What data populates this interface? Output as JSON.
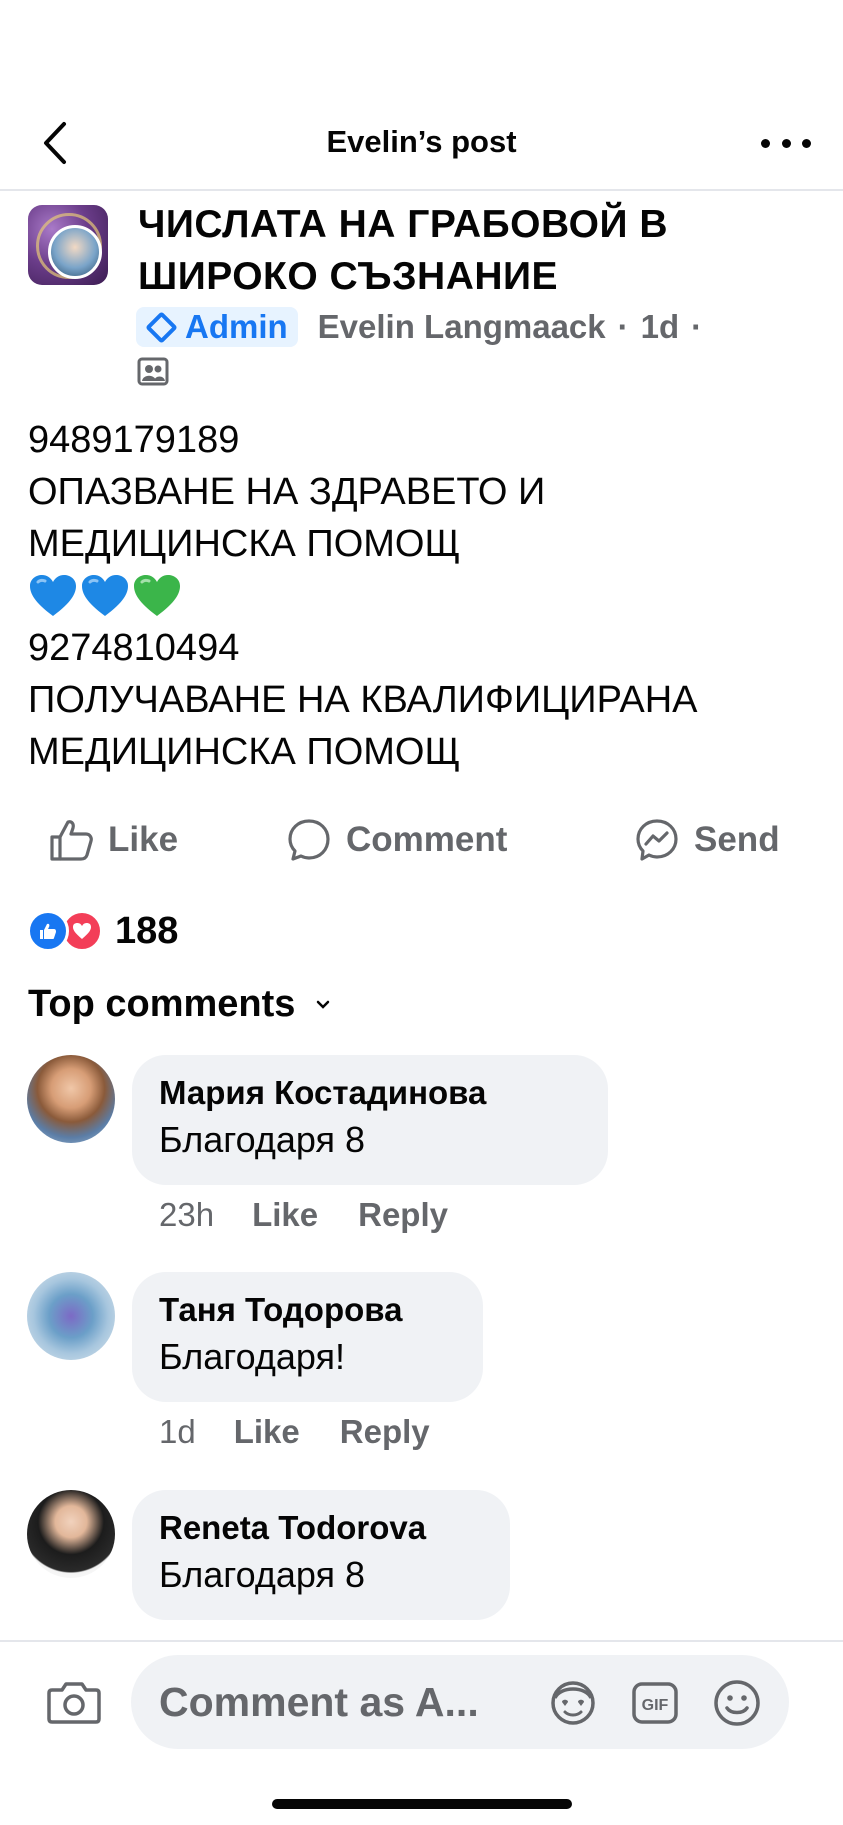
{
  "header": {
    "title": "Evelin’s post"
  },
  "post": {
    "group_name": "ЧИСЛАТА НА ГРАБОВОЙ В ШИРОКО СЪЗНАНИЕ",
    "admin_label": "Admin",
    "author": "Evelin Langmaack",
    "separator": "·",
    "time": "1d",
    "lines": [
      "9489179189",
      "ОПАЗВАНЕ НА ЗДРАВЕТО И",
      "МЕДИЦИНСКА ПОМОЩ",
      "9274810494",
      "ПОЛУЧАВАНЕ НА КВАЛИФИЦИРАНА",
      "МЕДИЦИНСКА ПОМОЩ"
    ],
    "emojis": [
      "blue-heart",
      "blue-heart",
      "green-heart"
    ]
  },
  "actions": {
    "like": "Like",
    "comment": "Comment",
    "send": "Send"
  },
  "reactions": {
    "count": "188",
    "types": [
      "like",
      "love"
    ]
  },
  "comments_section": {
    "title": "Top comments"
  },
  "comments": [
    {
      "name": "Мария Костадинова",
      "text": "Благодаря 8",
      "time": "23h",
      "like": "Like",
      "reply": "Reply"
    },
    {
      "name": "Таня Тодорова",
      "text": "Благодаря!",
      "time": "1d",
      "like": "Like",
      "reply": "Reply"
    },
    {
      "name": "Reneta Todorova",
      "text": "Благодаря 8"
    }
  ],
  "composer": {
    "placeholder": "Comment as A..."
  },
  "colors": {
    "accent": "#1877f2",
    "secondary_text": "#65676b",
    "bubble": "#f0f2f5",
    "love": "#f33e58",
    "blue_heart": "#1e88e5",
    "green_heart": "#3bb54a"
  }
}
